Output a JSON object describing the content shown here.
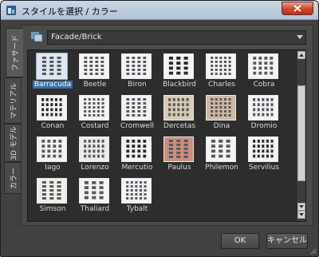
{
  "window": {
    "title": "スタイルを選択 / カラー"
  },
  "tabs": [
    {
      "label": "ファサード",
      "active": true
    },
    {
      "label": "マテリアル",
      "active": false
    },
    {
      "label": "3D モデル",
      "active": false
    },
    {
      "label": "カラー",
      "active": false
    }
  ],
  "category": {
    "value": "Facade/Brick"
  },
  "styles": [
    [
      "Barracuda",
      "Beetle",
      "Biron",
      "Blackbird",
      "Charles",
      "Cobra"
    ],
    [
      "Conan",
      "Costard",
      "Cromwell",
      "Dercetas",
      "Dina",
      "Dromio"
    ],
    [
      "Iago",
      "Lorenzo",
      "Mercutio",
      "Paulus",
      "Philemon",
      "Servilius"
    ],
    [
      "Simson",
      "Thaliard",
      "Tybalt"
    ]
  ],
  "selected_style": "Barracuda",
  "buttons": {
    "ok": "OK",
    "cancel": "キャンセル"
  },
  "colors": {
    "accent": "#3a6ea5",
    "panel": "#4a4a4a",
    "grid": "#2d2d2d",
    "close": "#c9452a"
  }
}
